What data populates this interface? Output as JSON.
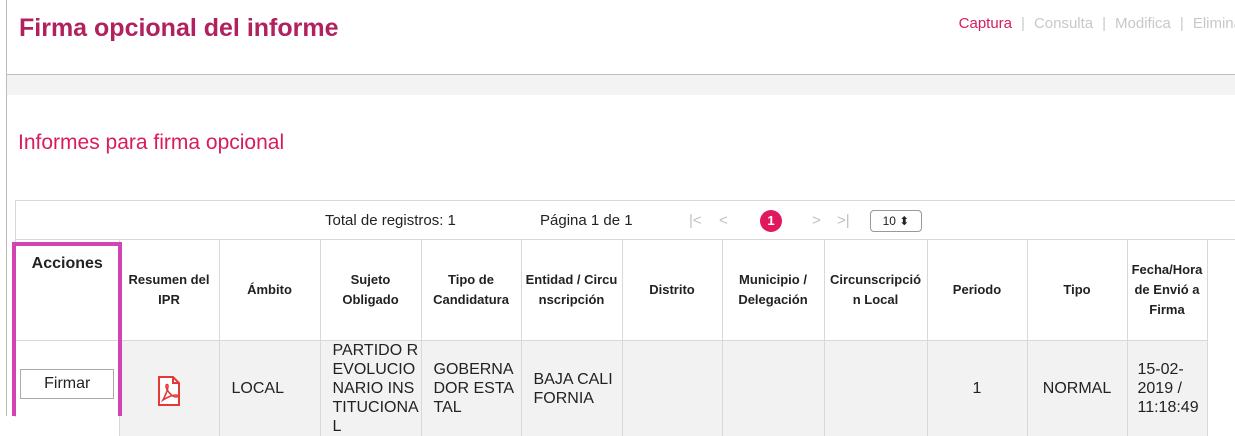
{
  "header": {
    "title": "Firma opcional del informe",
    "nav": [
      "Captura",
      "Consulta",
      "Modifica",
      "Elimina"
    ]
  },
  "section": {
    "title": "Informes para firma opcional"
  },
  "pager": {
    "total": "Total de registros: 1",
    "page": "Página 1 de 1",
    "first": "|<",
    "prev": "<",
    "current": "1",
    "next": ">",
    "last": ">|",
    "page_size": "10 ⬍"
  },
  "table": {
    "headers": {
      "acciones": "Acciones",
      "resumen": "Resumen del IPR",
      "ambito": "Ámbito",
      "sujeto": "Sujeto Obligado",
      "tipo_candidatura": "Tipo de Candidatura",
      "entidad": "Entidad / Circunscripción",
      "distrito": "Distrito",
      "municipio": "Municipio / Delegación",
      "circ_local": "Circunscripción Local",
      "periodo": "Periodo",
      "tipo": "Tipo",
      "fecha": "Fecha/Hora de Envió a Firma"
    },
    "row": {
      "action": "Firmar",
      "ambito": "LOCAL",
      "sujeto": "PARTIDO REVOLUCIONARIO INSTITUCIONAL",
      "tipo_candidatura": "GOBERNADOR ESTATAL",
      "entidad": "BAJA CALIFORNIA",
      "distrito": "",
      "municipio": "",
      "circ_local": "",
      "periodo": "1",
      "tipo": "NORMAL",
      "fecha": "15-02-2019 / 11:18:49"
    }
  },
  "colors": {
    "title": "#b0215e",
    "accent": "#d81b60",
    "highlight": "#d244b4"
  },
  "icons": {
    "resumen": "pdf-icon"
  }
}
